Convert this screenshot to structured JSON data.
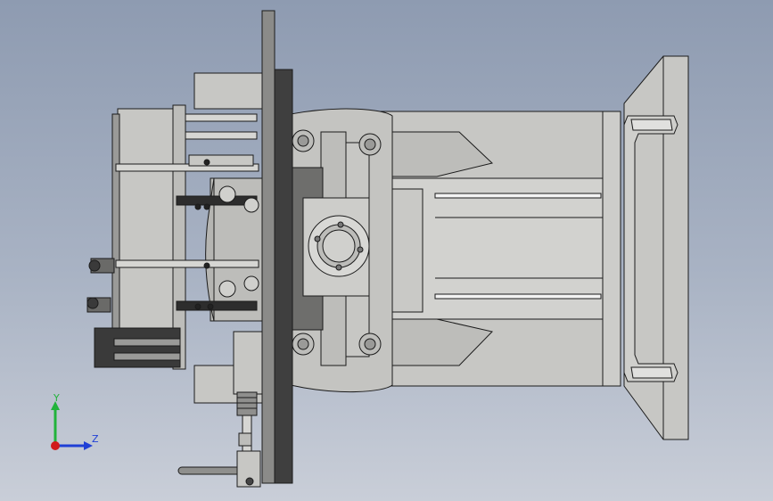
{
  "viewport": {
    "background_top": "#8e9bb1",
    "background_bottom": "#c9ced8"
  },
  "model": {
    "view": "side view",
    "palette": {
      "body_fill": "#c7c7c4",
      "body_light": "#d6d6d3",
      "dark_fill": "#4d4d4d",
      "flange_dark": "#3f3f3f",
      "edge": "#1b1b1b",
      "slot_white": "#f3f3f3"
    }
  },
  "triad": {
    "y_label": "Y",
    "z_label": "Z",
    "y_color": "#21b33b",
    "z_color": "#1f3fd6",
    "x_color": "#d11a1a"
  }
}
